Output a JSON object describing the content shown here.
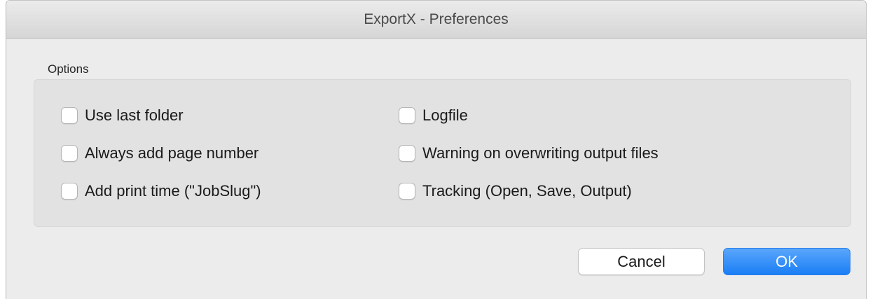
{
  "window": {
    "title": "ExportX - Preferences"
  },
  "options": {
    "group_label": "Options",
    "items": [
      {
        "label": "Use last folder",
        "checked": false
      },
      {
        "label": "Always add page number",
        "checked": false
      },
      {
        "label": "Add print time (\"JobSlug\")",
        "checked": false
      },
      {
        "label": "Logfile",
        "checked": false
      },
      {
        "label": "Warning on overwriting output files",
        "checked": false
      },
      {
        "label": "Tracking (Open, Save, Output)",
        "checked": false
      }
    ]
  },
  "buttons": {
    "cancel_label": "Cancel",
    "ok_label": "OK"
  },
  "colors": {
    "accent": "#1a7ef5",
    "window_bg": "#ececec",
    "group_bg": "#e2e2e2"
  }
}
